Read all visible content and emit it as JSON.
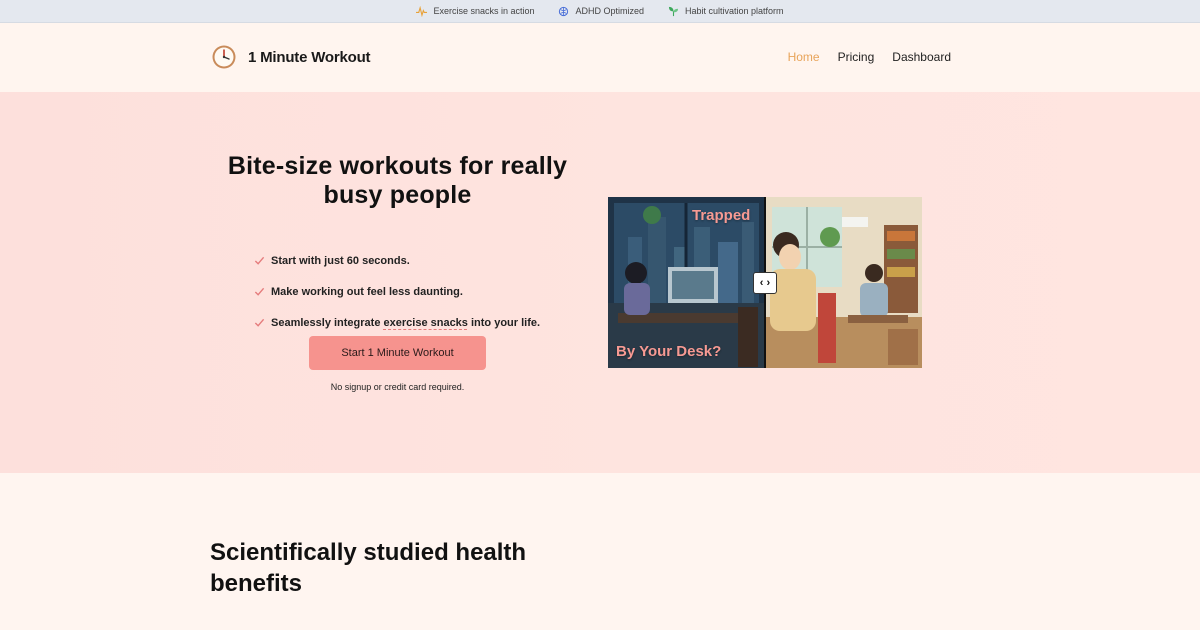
{
  "topbar": {
    "items": [
      {
        "label": "Exercise snacks in action",
        "icon": "pulse-icon",
        "color": "#e8a23a"
      },
      {
        "label": "ADHD Optimized",
        "icon": "brain-icon",
        "color": "#4a6fd8"
      },
      {
        "label": "Habit cultivation platform",
        "icon": "sprout-icon",
        "color": "#3da85c"
      }
    ]
  },
  "nav": {
    "brand": "1 Minute Workout",
    "links": [
      {
        "label": "Home",
        "active": true
      },
      {
        "label": "Pricing",
        "active": false
      },
      {
        "label": "Dashboard",
        "active": false
      }
    ]
  },
  "hero": {
    "title": "Bite-size workouts for really busy people",
    "features": {
      "f1": "Start with just 60 seconds.",
      "f2": "Make working out feel less daunting.",
      "f3_prefix": "Seamlessly integrate ",
      "f3_link": "exercise snacks",
      "f3_suffix": " into your life."
    },
    "cta_label": "Start 1 Minute Workout",
    "cta_note": "No signup or credit card required.",
    "comparison": {
      "top_label": "Trapped",
      "bottom_label": "By Your Desk?",
      "handle": "‹ ›"
    }
  },
  "benefits": {
    "title": "Scientifically studied health benefits"
  },
  "colors": {
    "accent": "#f6938e",
    "nav_active": "#e8a45a",
    "check": "#e57c7c"
  }
}
